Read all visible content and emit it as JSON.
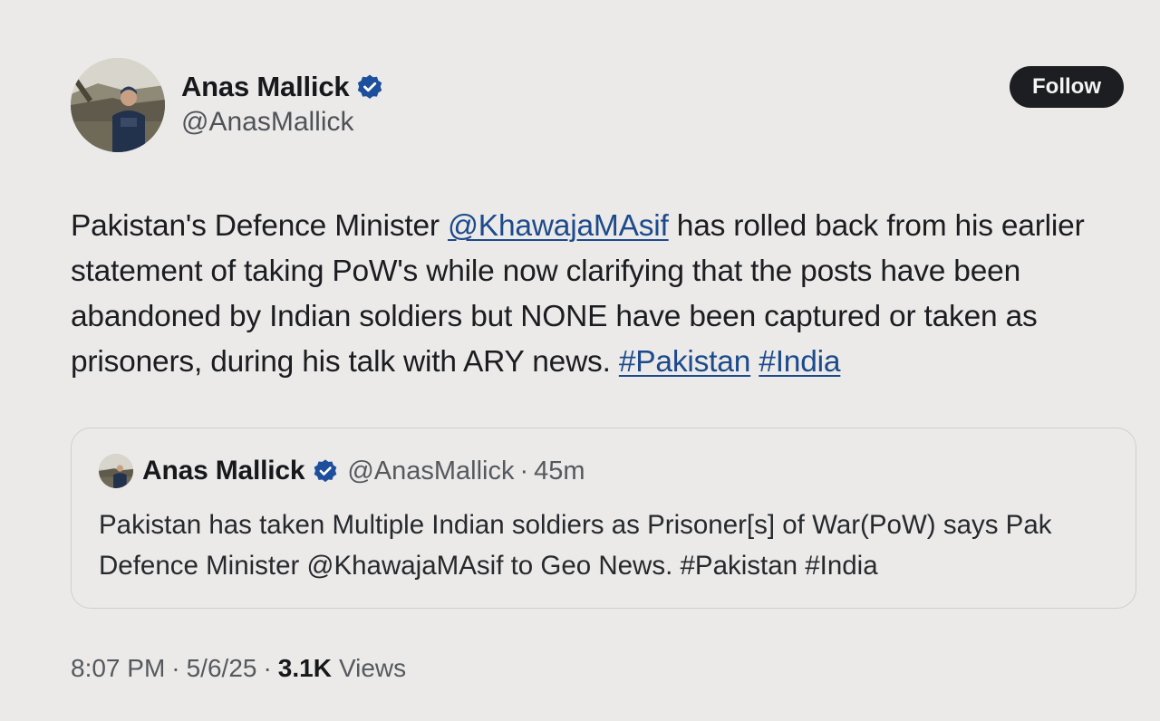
{
  "author": {
    "display_name": "Anas Mallick",
    "handle": "@AnasMallick",
    "verified": true
  },
  "follow_label": "Follow",
  "tweet": {
    "text_1": "Pakistan's Defence Minister ",
    "mention": "@KhawajaMAsif",
    "text_2": " has rolled back from his earlier statement of taking PoW's while now clarifying that the posts have been abandoned by Indian soldiers but NONE have been captured or taken as prisoners, during his talk with ARY news. ",
    "hashtag_1": "#Pakistan",
    "hashtag_2": "#India"
  },
  "quoted": {
    "display_name": "Anas Mallick",
    "handle": "@AnasMallick",
    "separator": "·",
    "time_ago": "45m",
    "text": "Pakistan has taken Multiple Indian soldiers as Prisoner[s] of War(PoW) says Pak Defence Minister @KhawajaMAsif to Geo News. #Pakistan #India"
  },
  "meta": {
    "time": "8:07 PM",
    "date": "5/6/25",
    "separator": "·",
    "views_count": "3.1K",
    "views_label": "Views"
  },
  "colors": {
    "background": "#ebeae8",
    "link": "#1c4a8c",
    "verified_badge": "#1d4f9c",
    "follow_button": "#1c1e22"
  },
  "icons": {
    "verified": "verified-badge-icon",
    "avatar": "avatar-photo"
  }
}
